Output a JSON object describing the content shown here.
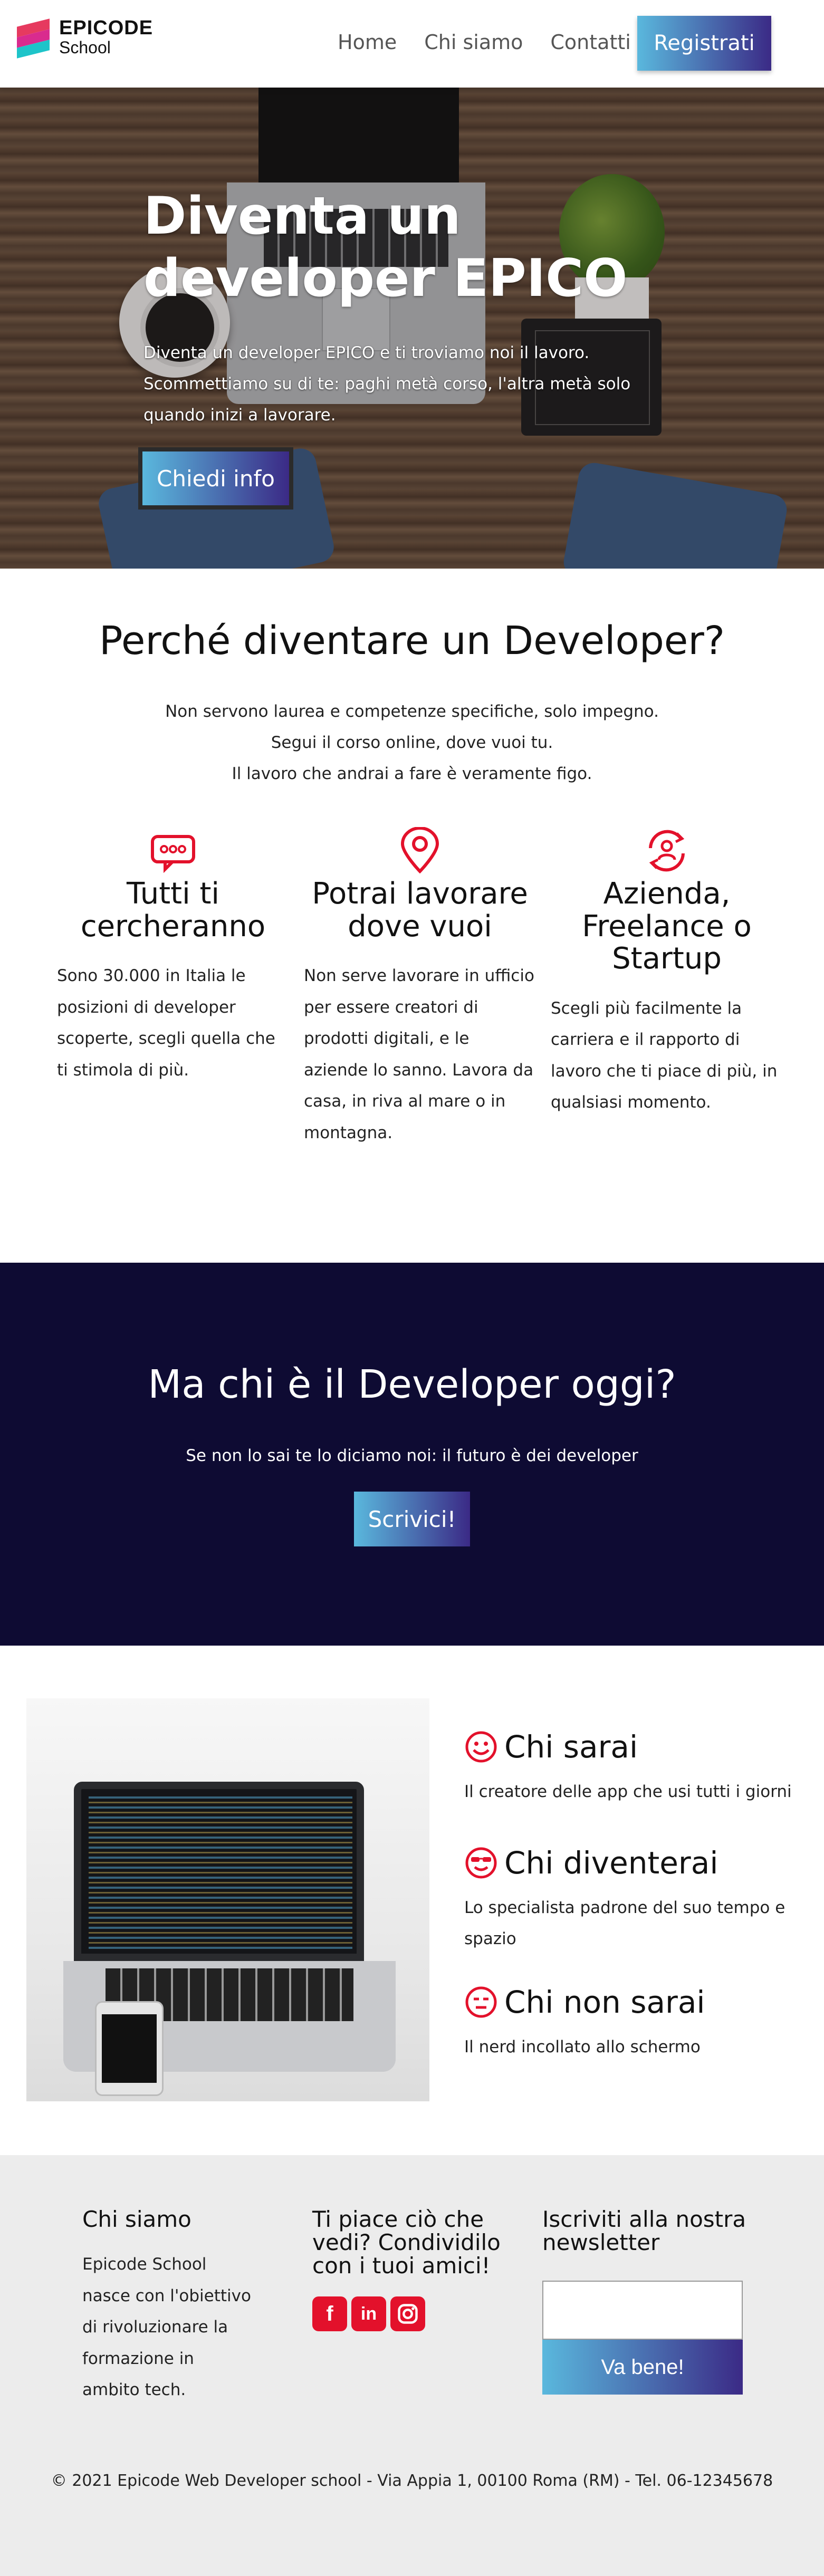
{
  "nav": {
    "logo_line1": "EPICODE",
    "logo_line2": "School",
    "links": [
      "Home",
      "Chi siamo",
      "Contatti"
    ],
    "register_label": "Registrati"
  },
  "hero": {
    "title": "Diventa un developer EPICO",
    "subtitle": "Diventa un developer EPICO e ti troviamo noi il lavoro. Scommettiamo su di te: paghi metà corso, l'altra metà solo quando inizi a lavorare.",
    "cta_label": "Chiedi info"
  },
  "why": {
    "title": "Perché diventare un Developer?",
    "lines": [
      "Non servono laurea e competenze specifiche, solo impegno.",
      "Segui il corso online, dove vuoi tu.",
      "Il lavoro che andrai a fare è veramente figo."
    ],
    "features": [
      {
        "icon": "chat-bubble-icon",
        "title": "Tutti ti cercheranno",
        "text": "Sono 30.000 in Italia le posizioni di developer scoperte, scegli quella che ti stimola di più."
      },
      {
        "icon": "location-pin-icon",
        "title": "Potrai lavorare dove vuoi",
        "text": "Non serve lavorare in ufficio per essere creatori di prodotti digitali, e le aziende lo sanno. Lavora da casa, in riva al mare o in montagna."
      },
      {
        "icon": "user-cycle-icon",
        "title": "Azienda, Freelance o Startup",
        "text": "Scegli più facilmente la carriera e il rapporto di lavoro che ti piace di più, in qualsiasi momento."
      }
    ]
  },
  "dark": {
    "title": "Ma chi è il Developer oggi?",
    "text": "Se non lo sai te lo diciamo noi: il futuro è dei developer",
    "button_label": "Scrivici!"
  },
  "about": {
    "items": [
      {
        "icon": "smile-icon",
        "title": "Chi sarai",
        "text": "Il creatore delle app che usi tutti i giorni"
      },
      {
        "icon": "cool-face-icon",
        "title": "Chi diventerai",
        "text": "Lo specialista padrone del suo tempo e spazio"
      },
      {
        "icon": "neutral-face-icon",
        "title": "Chi non sarai",
        "text": "Il nerd incollato allo schermo"
      }
    ]
  },
  "footer": {
    "col1_title": "Chi siamo",
    "col1_text": "Epicode School nasce con l'obiettivo di rivoluzionare la formazione in ambito tech.",
    "col2_title": "Ti piace ciò che vedi? Condividilo con i tuoi amici!",
    "col3_title": "Iscriviti alla nostra newsletter",
    "newsletter_value": "",
    "newsletter_button": "Va bene!",
    "copyright": "© 2021 Epicode Web Developer school - Via Appia 1, 00100 Roma (RM) - Tel. 06-12345678"
  },
  "colors": {
    "accent_red": "#e3112b",
    "dark_band": "#0e0b33",
    "gradient_start": "#5ab8dd",
    "gradient_end": "#3b2a86"
  }
}
